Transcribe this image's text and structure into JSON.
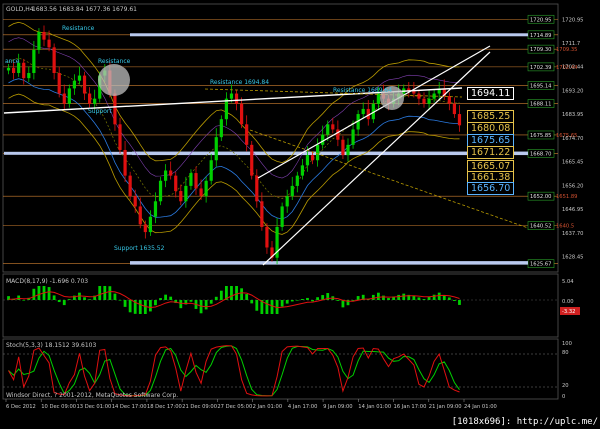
{
  "window": {
    "title": "GOLD,H4",
    "ohlc": "1683.56 1683.84 1677.36 1679.61"
  },
  "annotations": {
    "resistance_top": "Resistance",
    "resistance_mid": "Resistance",
    "resistance_1694": "Resistance 1694.84",
    "resistance_1689": "Resistance 1689.64",
    "support_1635": "Support 1635.52",
    "support_left": "Support",
    "resistance_far_left": "ance"
  },
  "price_tags": [
    {
      "label": "1694.11",
      "color": "#ffffff",
      "bind": "tag_1694"
    },
    {
      "label": "1685.25",
      "color": "#e6c24a",
      "bind": "tag_1685"
    },
    {
      "label": "1680.08",
      "color": "#e6c24a",
      "bind": "tag_1680"
    },
    {
      "label": "1675.65",
      "color": "#59b3ff",
      "bind": "tag_1675"
    },
    {
      "label": "1671.22",
      "color": "#e6c24a",
      "bind": "tag_1671"
    },
    {
      "label": "1665.07",
      "color": "#e6c24a",
      "bind": "tag_1665"
    },
    {
      "label": "1661.38",
      "color": "#e6c24a",
      "bind": "tag_1661"
    },
    {
      "label": "1656.70",
      "color": "#59b3ff",
      "bind": "tag_1656"
    }
  ],
  "tags": {
    "tag_1694": "1694.11",
    "tag_1685": "1685.25",
    "tag_1680": "1680.08",
    "tag_1675": "1675.65",
    "tag_1671": "1671.22",
    "tag_1665": "1665.07",
    "tag_1661": "1661.38",
    "tag_1656": "1656.70"
  },
  "price_axis": [
    "1720.95",
    "1711.7",
    "1702.44",
    "1693.20",
    "1683.95",
    "1674.70",
    "1665.45",
    "1656.20",
    "1646.95",
    "1637.70",
    "1628.45"
  ],
  "level_boxes": [
    "1720.95",
    "1714.89",
    "1709.30",
    "1702.39",
    "1695.14",
    "1688.11",
    "1675.85",
    "1668.70",
    "1652.00",
    "1640.52",
    "1625.67"
  ],
  "level_box_right": [
    "",
    "",
    "1709.35",
    "1702.44",
    "",
    "",
    "1675.65",
    "",
    "1651.89",
    "1640.5",
    ""
  ],
  "macd": {
    "label": "MACD(8,17,9) -1.696 0.703",
    "axis_top": "5.04",
    "axis_mid": "0.00",
    "axis_value": "-3.32"
  },
  "stoch": {
    "label": "Stoch(5,3,3) 18.1512 39.6103",
    "axis_top": "100",
    "axis_80": "80",
    "axis_20": "20",
    "axis_0": "0"
  },
  "footer": {
    "copyright": "Windsor Direct, ? 2001-2012, MetaQuotes Software Corp."
  },
  "time_axis": [
    "6 Dec 2012",
    "10 Dec 09:00",
    "13 Dec 01:00",
    "14 Dec 17:00",
    "18 Dec 17:00",
    "21 Dec 09:00",
    "27 Dec 05:00",
    "2 Jan 01:00",
    "4 Jan 17:00",
    "9 Jan 09:00",
    "14 Jan 01:00",
    "16 Jan 17:00",
    "21 Jan 09:00",
    "24 Jan 01:00"
  ],
  "watermark": "[1018x696]: http://uplc.me/",
  "colors": {
    "bull_candle": "#00d000",
    "bear_candle": "#e01010",
    "macd_hist": "#00d000",
    "macd_signal": "#e01010",
    "stoch_main": "#e01010",
    "stoch_signal": "#00d000",
    "level_line": "#d08030",
    "blue_band": "#b9c9ee",
    "trend_line": "#ffffff",
    "bollinger": "#b89a00",
    "ma_blue": "#2a7ae0"
  },
  "chart_data": {
    "type": "candlestick",
    "symbol": "GOLD",
    "timeframe": "H4",
    "ylim": [
      1624,
      1723
    ],
    "close_path": [
      1702,
      1700,
      1704,
      1698,
      1700,
      1709,
      1716,
      1713,
      1710,
      1700,
      1692,
      1688,
      1694,
      1697,
      1699,
      1692,
      1688,
      1690,
      1699,
      1701,
      1692,
      1680,
      1670,
      1660,
      1652,
      1648,
      1641,
      1638,
      1644,
      1650,
      1658,
      1662,
      1660,
      1654,
      1650,
      1656,
      1661,
      1655,
      1652,
      1658,
      1666,
      1675,
      1682,
      1690,
      1692,
      1688,
      1680,
      1672,
      1660,
      1650,
      1640,
      1632,
      1628,
      1640,
      1648,
      1652,
      1656,
      1660,
      1664,
      1668,
      1666,
      1672,
      1676,
      1680,
      1678,
      1674,
      1668,
      1672,
      1678,
      1684,
      1686,
      1682,
      1688,
      1692,
      1690,
      1688,
      1690,
      1692,
      1694,
      1693,
      1692,
      1690,
      1688,
      1690,
      1692,
      1694,
      1691,
      1688,
      1684,
      1679.61
    ]
  }
}
